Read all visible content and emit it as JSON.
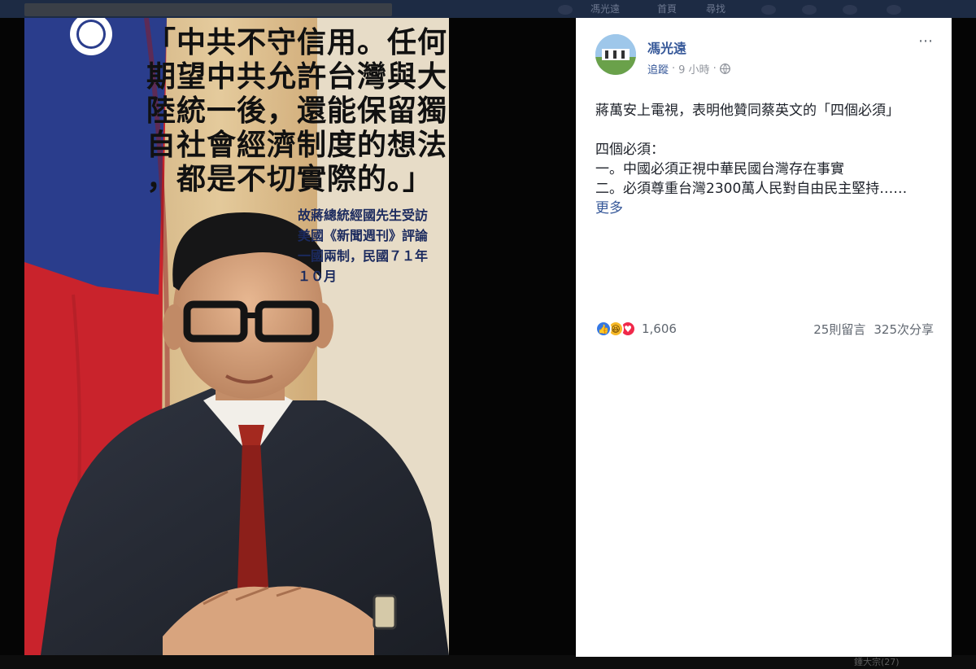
{
  "background": {
    "nav_labels": [
      "馮光遠",
      "首頁",
      "尋找"
    ],
    "bottom_caption": "鍾大宗(27)"
  },
  "photo": {
    "quote": "「中共不守信用。任何\n期望中共允許台灣與大\n陸統一後，還能保留獨\n自社會經濟制度的想法\n，都是不切實際的。」",
    "caption": "故蔣總統經國先生受訪\n美國《新聞週刊》評論\n一國兩制，民國７１年\n１０月"
  },
  "post": {
    "author": "馮光遠",
    "follow_label": "追蹤",
    "time": "9 小時",
    "separator": "·",
    "more_icon": "⋯",
    "paragraphs": [
      "蔣萬安上電視，表明他贊同蔡英文的「四個必須」",
      "",
      "四個必須：",
      "一。中國必須正視中華民國台灣存在事實",
      "二。必須尊重台灣2300萬人民對自由民主堅持……"
    ],
    "see_more": "更多",
    "reactions": {
      "icons": [
        "like-icon",
        "haha-icon",
        "love-icon"
      ],
      "count": "1,606"
    },
    "comments": "25則留言",
    "shares": "325次分享"
  },
  "colors": {
    "link": "#365899",
    "panel": "#ffffff",
    "backdrop": "#050505",
    "like": "#3578e5",
    "haha": "#f7b928",
    "love": "#f0284a"
  }
}
